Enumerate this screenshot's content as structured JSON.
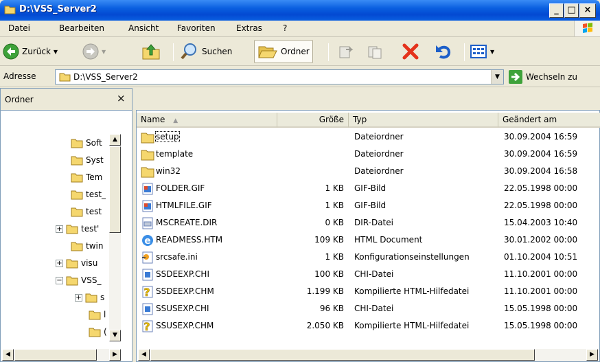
{
  "window": {
    "title": "D:\\VSS_Server2",
    "min_label": "_",
    "max_label": "□",
    "close_label": "×"
  },
  "menu": [
    "Datei",
    "Bearbeiten",
    "Ansicht",
    "Favoriten",
    "Extras",
    "?"
  ],
  "toolbar": {
    "back_label": "Zurück",
    "search_label": "Suchen",
    "folders_label": "Ordner"
  },
  "address": {
    "label": "Adresse",
    "value": "D:\\VSS_Server2",
    "go_label": "Wechseln zu"
  },
  "folder_pane": {
    "title": "Ordner",
    "close": "×",
    "items": [
      {
        "label": "Soft",
        "expander": ""
      },
      {
        "label": "Syst",
        "expander": ""
      },
      {
        "label": "Tem",
        "expander": ""
      },
      {
        "label": "test_",
        "expander": ""
      },
      {
        "label": "test",
        "expander": ""
      },
      {
        "label": "test'",
        "expander": "+"
      },
      {
        "label": "twin",
        "expander": ""
      },
      {
        "label": "visu",
        "expander": "+"
      },
      {
        "label": "VSS_",
        "expander": "−"
      },
      {
        "label": "s",
        "expander": "+"
      },
      {
        "label": "l",
        "expander": ""
      },
      {
        "label": "(",
        "expander": ""
      }
    ]
  },
  "columns": {
    "name": "Name",
    "size": "Größe",
    "type": "Typ",
    "modified": "Geändert am"
  },
  "files": [
    {
      "name": "setup",
      "size": "",
      "type": "Dateiordner",
      "modified": "30.09.2004 16:59",
      "icon": "folder-icon"
    },
    {
      "name": "template",
      "size": "",
      "type": "Dateiordner",
      "modified": "30.09.2004 16:59",
      "icon": "folder-icon"
    },
    {
      "name": "win32",
      "size": "",
      "type": "Dateiordner",
      "modified": "30.09.2004 16:58",
      "icon": "folder-icon"
    },
    {
      "name": "FOLDER.GIF",
      "size": "1 KB",
      "type": "GIF-Bild",
      "modified": "22.05.1998 00:00",
      "icon": "gif-image-icon"
    },
    {
      "name": "HTMLFILE.GIF",
      "size": "1 KB",
      "type": "GIF-Bild",
      "modified": "22.05.1998 00:00",
      "icon": "gif-image-icon"
    },
    {
      "name": "MSCREATE.DIR",
      "size": "0 KB",
      "type": "DIR-Datei",
      "modified": "15.04.2003 10:40",
      "icon": "dir-file-icon"
    },
    {
      "name": "READMESS.HTM",
      "size": "109 KB",
      "type": "HTML Document",
      "modified": "30.01.2002 00:00",
      "icon": "html-document-icon"
    },
    {
      "name": "srcsafe.ini",
      "size": "1 KB",
      "type": "Konfigurationseinstellungen",
      "modified": "01.10.2004 10:51",
      "icon": "ini-settings-icon"
    },
    {
      "name": "SSDEEXP.CHI",
      "size": "100 KB",
      "type": "CHI-Datei",
      "modified": "11.10.2001 00:00",
      "icon": "chi-file-icon"
    },
    {
      "name": "SSDEEXP.CHM",
      "size": "1.199 KB",
      "type": "Kompilierte HTML-Hilfedatei",
      "modified": "11.10.2001 00:00",
      "icon": "chm-help-icon"
    },
    {
      "name": "SSUSEXP.CHI",
      "size": "96 KB",
      "type": "CHI-Datei",
      "modified": "15.05.1998 00:00",
      "icon": "chi-file-icon"
    },
    {
      "name": "SSUSEXP.CHM",
      "size": "2.050 KB",
      "type": "Kompilierte HTML-Hilfedatei",
      "modified": "15.05.1998 00:00",
      "icon": "chm-help-icon"
    }
  ],
  "colors": {
    "title_bar": "#0a5fe0",
    "window_bg": "#ece9d8",
    "folder": "#f5d76e"
  }
}
